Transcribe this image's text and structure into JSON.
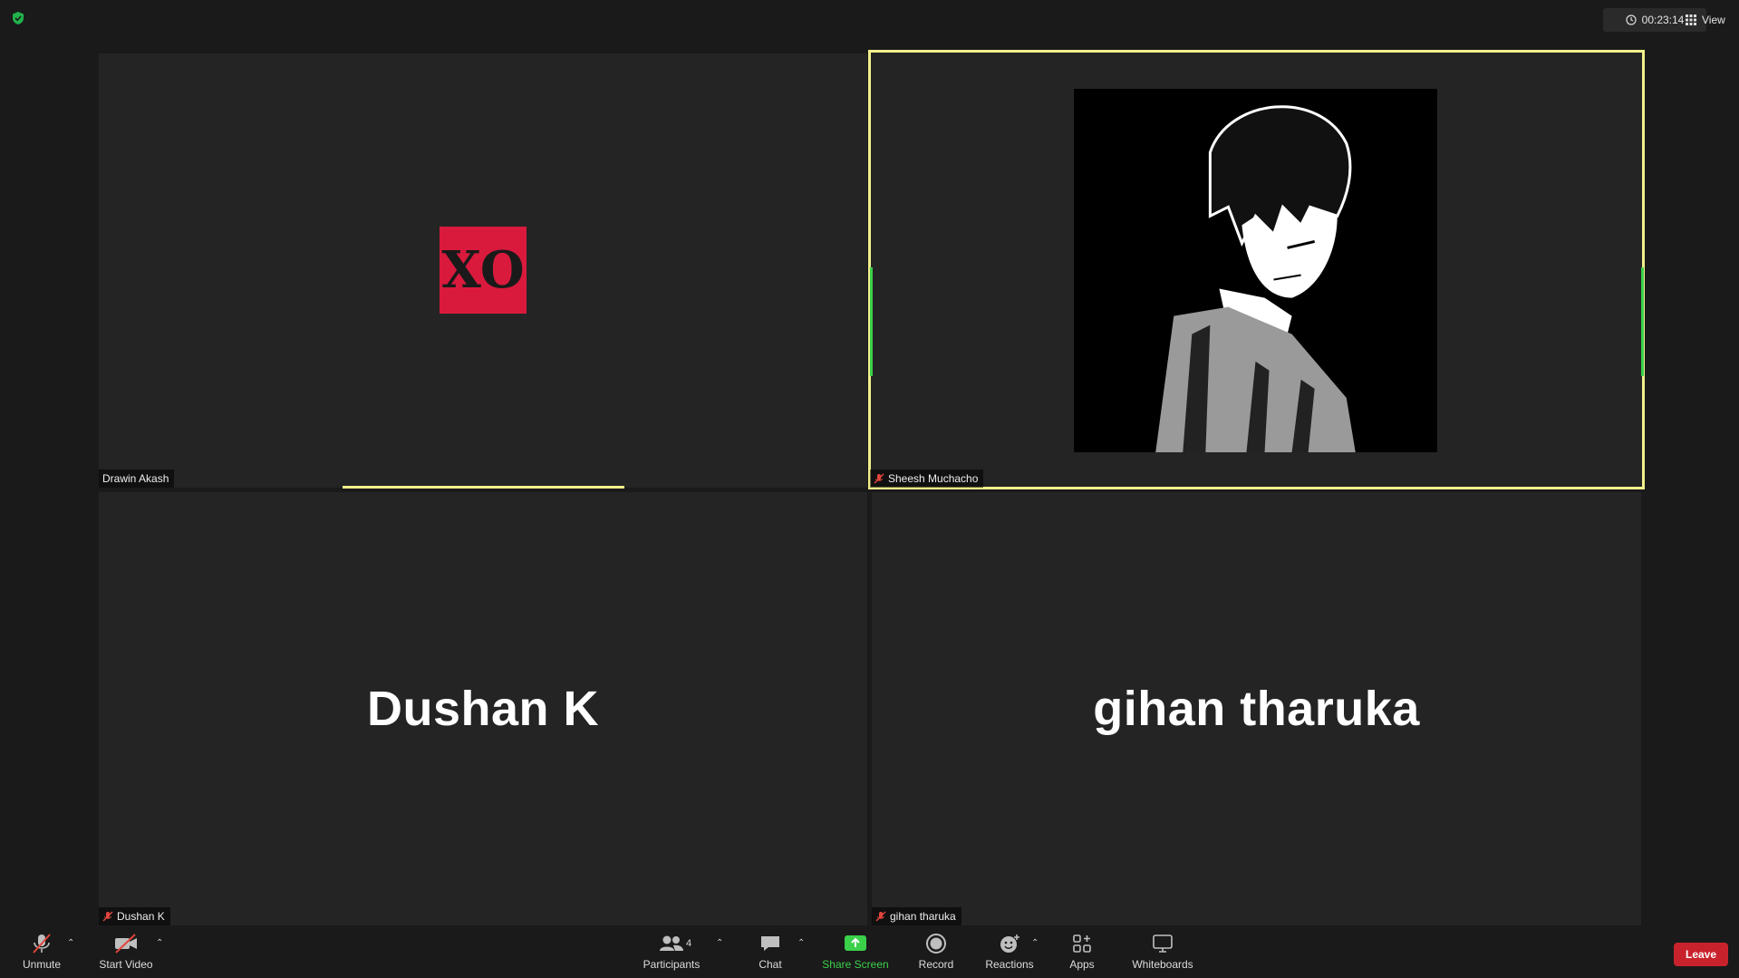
{
  "top": {
    "timer": "00:23:14",
    "view_label": "View"
  },
  "tiles": [
    {
      "name": "Drawin Akash",
      "avatar": "XO"
    },
    {
      "name": "Sheesh Muchacho"
    },
    {
      "name": "Dushan K",
      "display": "Dushan K"
    },
    {
      "name": "gihan tharuka",
      "display": "gihan tharuka"
    }
  ],
  "toolbar": {
    "unmute": "Unmute",
    "start_video": "Start Video",
    "participants": "Participants",
    "participant_count": "4",
    "chat": "Chat",
    "share_screen": "Share Screen",
    "record": "Record",
    "reactions": "Reactions",
    "apps": "Apps",
    "whiteboards": "Whiteboards",
    "leave": "Leave"
  },
  "colors": {
    "active_speaker": "#f1f08c",
    "share_green": "#3bd04a",
    "leave_red": "#c8232c",
    "muted_red": "#e0453b"
  }
}
